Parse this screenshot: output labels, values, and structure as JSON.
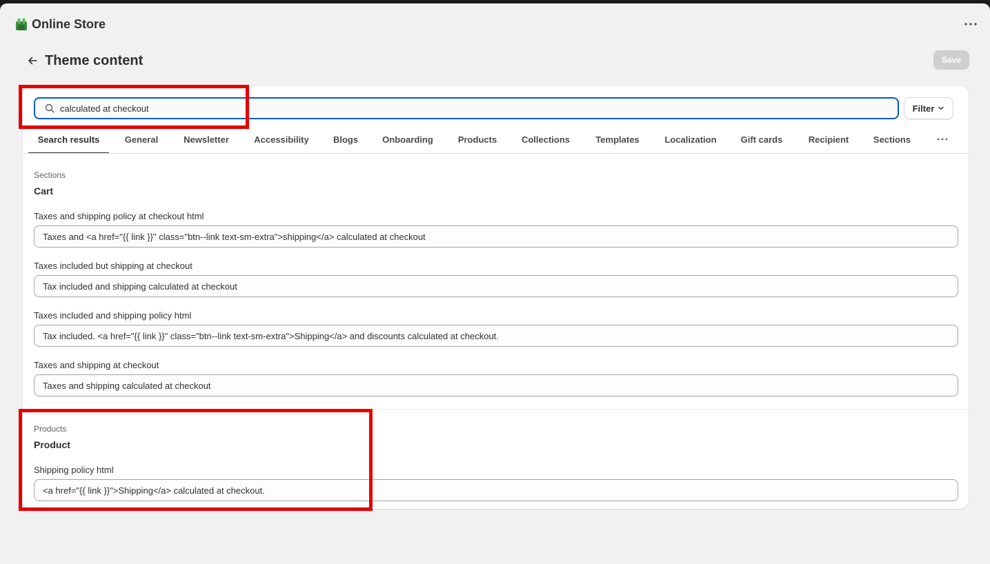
{
  "app": {
    "title": "Online Store",
    "logo_icon": "shopify-bag-icon",
    "more_icon": "ellipsis-horizontal-icon"
  },
  "page": {
    "title": "Theme content",
    "back_icon": "arrow-left-icon",
    "save_label": "Save"
  },
  "search": {
    "value": "calculated at checkout",
    "placeholder": "",
    "icon": "search-icon"
  },
  "filter": {
    "label": "Filter",
    "icon": "chevron-down-icon"
  },
  "tabs": [
    {
      "label": "Search results",
      "active": true
    },
    {
      "label": "General"
    },
    {
      "label": "Newsletter"
    },
    {
      "label": "Accessibility"
    },
    {
      "label": "Blogs"
    },
    {
      "label": "Onboarding"
    },
    {
      "label": "Products"
    },
    {
      "label": "Collections"
    },
    {
      "label": "Templates"
    },
    {
      "label": "Localization"
    },
    {
      "label": "Gift cards"
    },
    {
      "label": "Recipient"
    },
    {
      "label": "Sections"
    }
  ],
  "tabs_more_icon": "ellipsis-horizontal-icon",
  "groups": [
    {
      "caption": "Sections",
      "title": "Cart",
      "fields": [
        {
          "label": "Taxes and shipping policy at checkout html",
          "value": "Taxes and <a href=\"{{ link }}\" class=\"btn--link text-sm-extra\">shipping</a> calculated at checkout"
        },
        {
          "label": "Taxes included but shipping at checkout",
          "value": "Tax included and shipping calculated at checkout"
        },
        {
          "label": "Taxes included and shipping policy html",
          "value": "Tax included. <a href=\"{{ link }}\" class=\"btn--link text-sm-extra\">Shipping</a> and discounts calculated at checkout."
        },
        {
          "label": "Taxes and shipping at checkout",
          "value": "Taxes and shipping calculated at checkout"
        }
      ]
    },
    {
      "caption": "Products",
      "title": "Product",
      "fields": [
        {
          "label": "Shipping policy html",
          "value": "<a href=\"{{ link }}\">Shipping</a> calculated at checkout."
        }
      ]
    }
  ],
  "colors": {
    "focus_ring": "#005bd3",
    "annotation": "#e60000",
    "save_disabled": "#cfcfcf"
  }
}
